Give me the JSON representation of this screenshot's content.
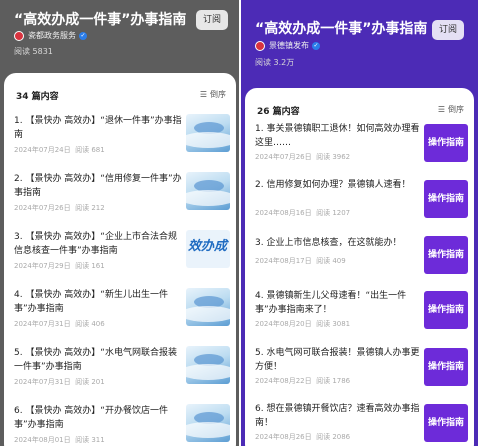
{
  "left": {
    "title": "“高效办成一件事”办事指南",
    "subscribe": "订阅",
    "author": "瓷都政务服务",
    "reads": "阅读 5831",
    "count": "34 篇内容",
    "sort": "倒序",
    "items": [
      {
        "title": "1. 【景快办 高效办】“退休一件事”办事指南",
        "date": "2024年07月24日",
        "reads": "阅读 681"
      },
      {
        "title": "2. 【景快办 高效办】“信用修复一件事”办事指南",
        "date": "2024年07月26日",
        "reads": "阅读 212"
      },
      {
        "title": "3. 【景快办 高效办】“企业上市合法合规信息核查一件事”办事指南",
        "date": "2024年07月29日",
        "reads": "阅读 161"
      },
      {
        "title": "4. 【景快办 高效办】“新生儿出生一件事”办事指南",
        "date": "2024年07月31日",
        "reads": "阅读 406"
      },
      {
        "title": "5. 【景快办 高效办】“水电气网联合报装一件事”办事指南",
        "date": "2024年07月31日",
        "reads": "阅读 201"
      },
      {
        "title": "6. 【景快办 高效办】“开办餐饮店一件事”办事指南",
        "date": "2024年08月01日",
        "reads": "阅读 311"
      }
    ],
    "thumb3_text": "效办成"
  },
  "right": {
    "title": "“高效办成一件事”办事指南",
    "subscribe": "订阅",
    "author": "景德镇发布",
    "reads": "阅读 3.2万",
    "count": "26 篇内容",
    "sort": "倒序",
    "thumb_text": "操作指南",
    "items": [
      {
        "title": "1. 事关景德镇职工退休！如何高效办理看这里……",
        "date": "2024年07月26日",
        "reads": "阅读 3962"
      },
      {
        "title": "2. 信用修复如何办理？景德镇人速看！",
        "date": "2024年08月16日",
        "reads": "阅读 1207"
      },
      {
        "title": "3. 企业上市信息核查，在这就能办！",
        "date": "2024年08月17日",
        "reads": "阅读 409"
      },
      {
        "title": "4. 景德镇新生儿父母速看！“出生一件事”办事指南来了！",
        "date": "2024年08月20日",
        "reads": "阅读 3081"
      },
      {
        "title": "5. 水电气网可联合报装！景德镇人办事更方便！",
        "date": "2024年08月22日",
        "reads": "阅读 1786"
      },
      {
        "title": "6. 想在景德镇开餐饮店？速看高效办事指南！",
        "date": "2024年08月26日",
        "reads": "阅读 2086"
      }
    ]
  },
  "colors": {
    "left_header": "#5d5d5d",
    "right_header": "#4c2bb6",
    "thumb_purple": "#6d2bd9"
  }
}
